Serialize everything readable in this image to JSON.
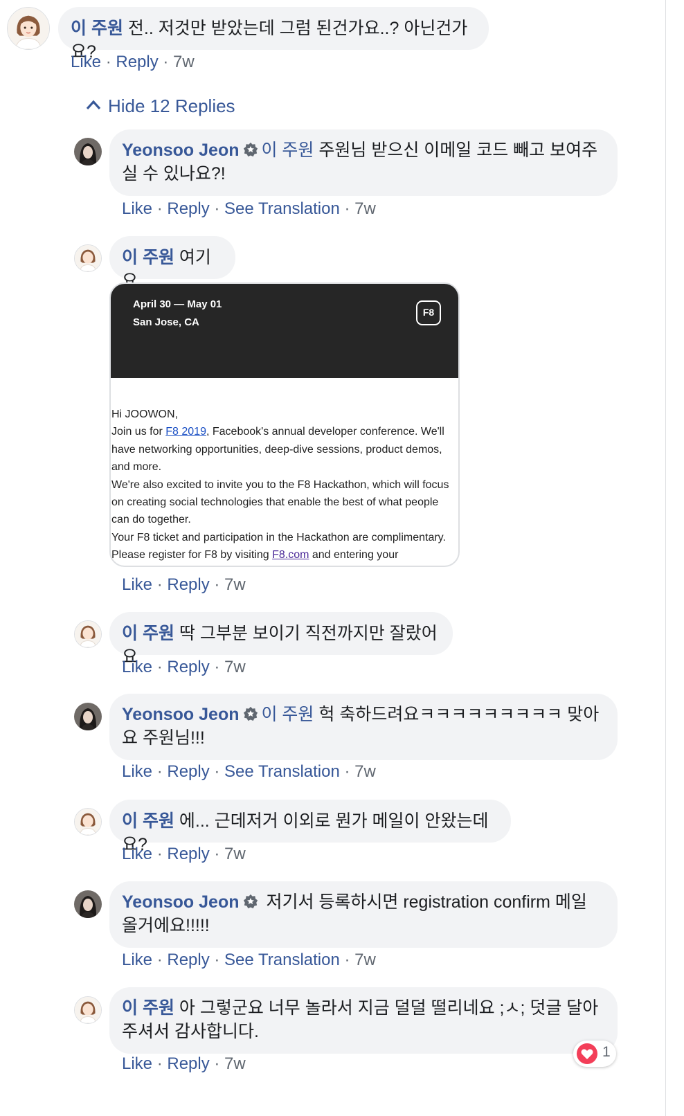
{
  "comments": [
    {
      "name": "이 주원",
      "text": "전.. 저것만 받았는데 그럼 된건가요..? 아닌건가요?",
      "like": "Like",
      "reply": "Reply",
      "time": "7w"
    },
    {
      "name": "Yeonsoo Jeon",
      "mention": "이 주원",
      "text": "주원님 받으신 이메일 코드 빼고 보여주실 수 있나요?!",
      "like": "Like",
      "reply": "Reply",
      "translate": "See Translation",
      "time": "7w"
    },
    {
      "name": "이 주원",
      "text": "여기요",
      "like": "Like",
      "reply": "Reply",
      "time": "7w"
    },
    {
      "name": "이 주원",
      "text": "딱 그부분 보이기 직전까지만 잘랐어요",
      "like": "Like",
      "reply": "Reply",
      "time": "7w"
    },
    {
      "name": "Yeonsoo Jeon",
      "mention": "이 주원",
      "text": "헉 축하드려요ㅋㅋㅋㅋㅋㅋㅋㅋㅋ 맞아요 주원님!!!",
      "like": "Like",
      "reply": "Reply",
      "translate": "See Translation",
      "time": "7w"
    },
    {
      "name": "이 주원",
      "text": "에... 근데저거 이외로 뭔가 메일이 안왔는데요?",
      "like": "Like",
      "reply": "Reply",
      "time": "7w"
    },
    {
      "name": "Yeonsoo Jeon",
      "text": "저기서 등록하시면 registration confirm 메일 올거에요!!!!!",
      "like": "Like",
      "reply": "Reply",
      "translate": "See Translation",
      "time": "7w"
    },
    {
      "name": "이 주원",
      "text": "아 그렇군요 너무 놀라서 지금 덜덜 떨리네요 ;ㅅ; 덧글 달아주셔서 감사합니다.",
      "like": "Like",
      "reply": "Reply",
      "time": "7w",
      "reaction_count": "1"
    }
  ],
  "hide_replies": "Hide 12 Replies",
  "email": {
    "date": "April 30 — May 01",
    "location": "San Jose, CA",
    "logo": "F8",
    "greeting": "Hi JOOWON,",
    "p1_pre": "Join us for ",
    "p1_link": "F8 2019",
    "p1_post": ", Facebook's annual developer conference. We'll have networking opportunities, deep-dive sessions, product demos, and more.",
    "p2": "We're also excited to invite you to the F8 Hackathon, which will focus on creating social technologies that enable the best of what people can do together.",
    "p3": "Your F8 ticket and participation in the Hackathon are complimentary.",
    "p4_pre": "Please register for F8 by visiting ",
    "p4_link": "F8.com",
    "p4_post": " and entering your"
  },
  "colors": {
    "link": "#385898",
    "bubble": "#f2f3f5",
    "meta": "#606770",
    "heart": "#f33e58"
  }
}
